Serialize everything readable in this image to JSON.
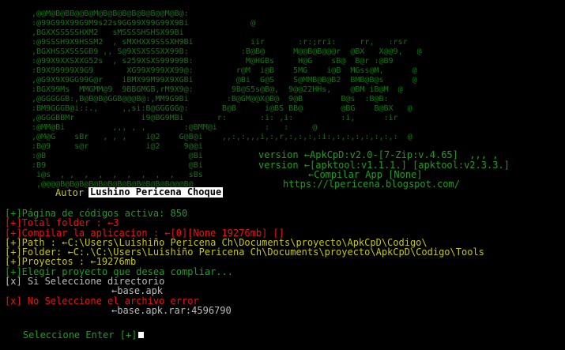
{
  "colors": {
    "background": "#000000",
    "art": "#0c7a0c",
    "accent_green": "#1d9f1d",
    "red": "#ee1111",
    "yellow": "#c7c70a"
  },
  "banner": {
    "art_lines": [
      ",@@M@B@BB@@B@M@B@B@B@B@B@B@@M@B@:",
      ":@99G99X99G9M9s22s9GG99X99G99X9Bi             @",
      ",BGXXSS5SSHXM2   sMSSSSHSHSX99Bi",
      ":@9SSSH9X9HSSM2  , sMXHXX9SSSXH9Bi            iir       :r:;rri:     rr,   :rsr",
      ",BGXHSSXSSSGB9 ,, S@9XSXSSSXX99B:           :B@B@      M@@B@B@@@r  @BX   X@@9,   @",
      ":@99X9XXSXXG52s  , s259XSXS99999B:           M@HGBs     H@G    sB@  B@r :@B9",
      ":B9X99999X9G9       XG99X999XX99@:         r@M  i@B    5MG    i@B  MGss@M,      @",
      ",@G9X9X9GG99G@r    iBMX99M99X9XGBi         @Bi  G@S    S@MMB@B@B2  BMB@B@s      @",
      ":BGX99Ms  MMGMM@9  9BBGMGB,rM9X9@:        9B@S5s@B@,  9@@22HHs,    @BM iB@M  @",
      ",@GGGGGB:,B@B@B@GGB@@@B@:,MM9G9Bi        :B@GM@@X@B@  9@B        B@s  :B@B:",
      ":BM9GGGB@i::.,     ,,si:B@GGGGG@:       B@B      i@BS BB@        @BG    B@BX   @",
      ",@GGGBBMr              i9@BG9MBi       r:       :i: ,i:          :i,      :ir",
      ":@MM@Bi          ,,, , ,        :@BMM@i          :   :     @",
      ",@M@G    sBr   , , ,    i@2    G@B@i    ,,:,:,,,i,:,r,:,:,:,:i:,:,:,:,:,:,:,:  @",
      ":B@9     s@r            i@2     9@@i",
      ":@B                              @Bi",
      ":B9                              @Bi",
      " i@s  , ,  ,  ,  ,  ,  ,  ,  ,   sBs",
      " ,@@@@B@B@B@B@B@B@B@B@B@B@B@B@@@B@"
    ],
    "author_label": "Autor",
    "author_name": "Lushino Pericena Choque",
    "version_line_1": "version ←ApkCpD:v2.0-[7-Zip:v.4.65]  ,,, ,",
    "version_line_2": "version ←[apktool:v1.1.1.] [apktool:v2.3.3.]",
    "compile_label": "←Compilar App [None]",
    "blog_url": "https://lpericena.blogspot.com/"
  },
  "status": {
    "codepage": "[+]Página de códigos activa: 850",
    "total_folder": "[+]Total folder : ←3",
    "compile": "[+]Compilar la aplicacion : ←[0][None 19276mb] []",
    "path": "[+]Path : ←C:\\Users\\Luishiño Pericena Ch\\Documents\\proyecto\\ApkCpD\\Codigo\\",
    "folder": "[+]Folder: ←C:.\\C:\\Users\\Luishiño Pericena Ch\\Documents\\proyecto\\ApkCpD\\Codigo\\Tools",
    "projects": "[+]Proyectos : ←19276mb",
    "choose": "[+]Elegir proyecto que desea compliar...",
    "dir_selected": "[x] Si Seleccione directorio",
    "dir_file": "←base.apk",
    "not_selected": "[x] No Seleccione el archivo error",
    "rar_file": "←base.apk.rar:4596790",
    "prompt": "Seleccione Enter [+]"
  }
}
